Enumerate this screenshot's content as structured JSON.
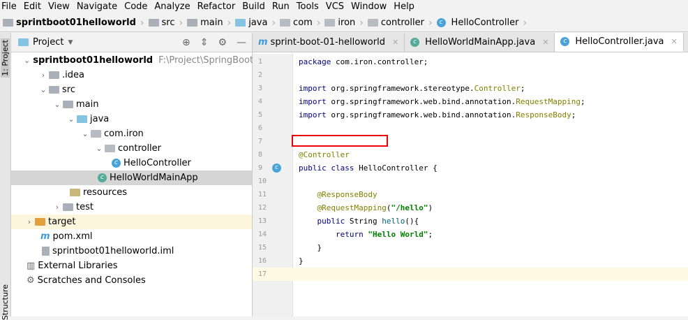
{
  "menu": [
    "File",
    "Edit",
    "View",
    "Navigate",
    "Code",
    "Analyze",
    "Refactor",
    "Build",
    "Run",
    "Tools",
    "VCS",
    "Window",
    "Help"
  ],
  "breadcrumb": [
    "sprintboot01helloworld",
    "src",
    "main",
    "java",
    "com",
    "iron",
    "controller",
    "HelloController"
  ],
  "side_tabs": {
    "project": "1: Project",
    "structure": "Structure"
  },
  "project_panel": {
    "title": "Project"
  },
  "tree": [
    {
      "label": "sprintboot01helloworld",
      "path": "F:\\Project\\SpringBoot\\spri"
    },
    {
      "label": ".idea"
    },
    {
      "label": "src"
    },
    {
      "label": "main"
    },
    {
      "label": "java"
    },
    {
      "label": "com.iron"
    },
    {
      "label": "controller"
    },
    {
      "label": "HelloController"
    },
    {
      "label": "HelloWorldMainApp"
    },
    {
      "label": "resources"
    },
    {
      "label": "test"
    },
    {
      "label": "target"
    },
    {
      "label": "pom.xml"
    },
    {
      "label": "sprintboot01helloworld.iml"
    },
    {
      "label": "External Libraries"
    },
    {
      "label": "Scratches and Consoles"
    }
  ],
  "tabs": [
    "sprint-boot-01-helloworld",
    "HelloWorldMainApp.java",
    "HelloController.java"
  ],
  "lines": [
    "1",
    "2",
    "3",
    "4",
    "5",
    "6",
    "7",
    "8",
    "9",
    "10",
    "11",
    "12",
    "13",
    "14",
    "15",
    "16",
    "17"
  ]
}
